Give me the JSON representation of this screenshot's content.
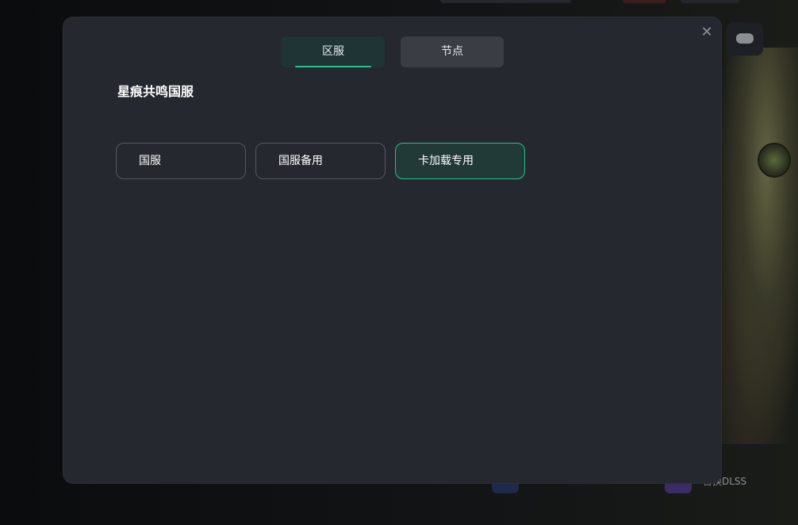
{
  "background": {
    "bottom_label": "替换DLSS",
    "gamepad_icon": "gamepad-icon"
  },
  "dialog": {
    "close_icon": "close-icon",
    "tabs": [
      {
        "label": "区服",
        "active": true
      },
      {
        "label": "节点",
        "active": false
      }
    ],
    "section_title": "星痕共鸣国服",
    "options": [
      {
        "label": "国服",
        "selected": false
      },
      {
        "label": "国服备用",
        "selected": false
      },
      {
        "label": "卡加载专用",
        "selected": true
      }
    ]
  },
  "colors": {
    "accent": "#27c28f",
    "dialog_bg": "#25282f",
    "tab_active_bg": "#1f3535",
    "tab_inactive_bg": "#3a3d44",
    "selected_bg": "#213a38"
  }
}
